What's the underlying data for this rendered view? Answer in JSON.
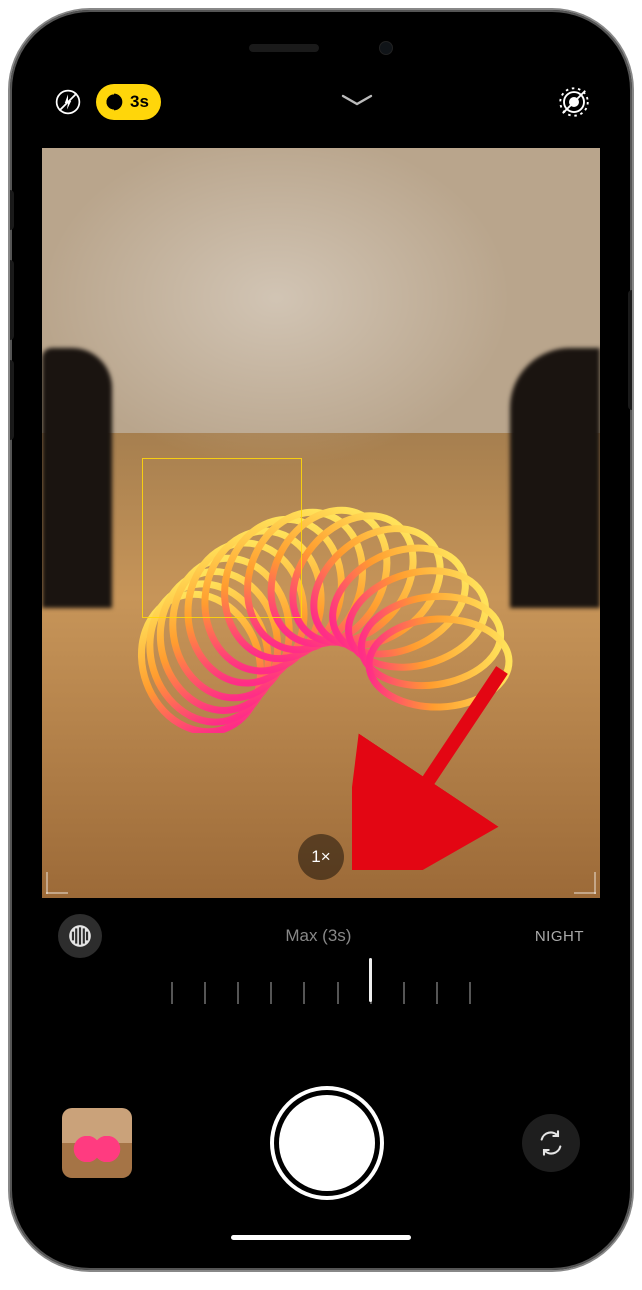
{
  "topbar": {
    "flash_state": "off",
    "night_mode_label": "3s",
    "live_photo_state": "off"
  },
  "viewfinder": {
    "zoom_label": "1×"
  },
  "slider": {
    "label": "Max (3s)",
    "mode_label": "NIGHT",
    "tick_count": 10
  },
  "icons": {
    "flash": "flash-off-icon",
    "night": "night-mode-icon",
    "chevron": "chevron-down-icon",
    "live": "live-photo-off-icon",
    "night_small": "night-mode-icon",
    "swap": "camera-swap-icon"
  }
}
